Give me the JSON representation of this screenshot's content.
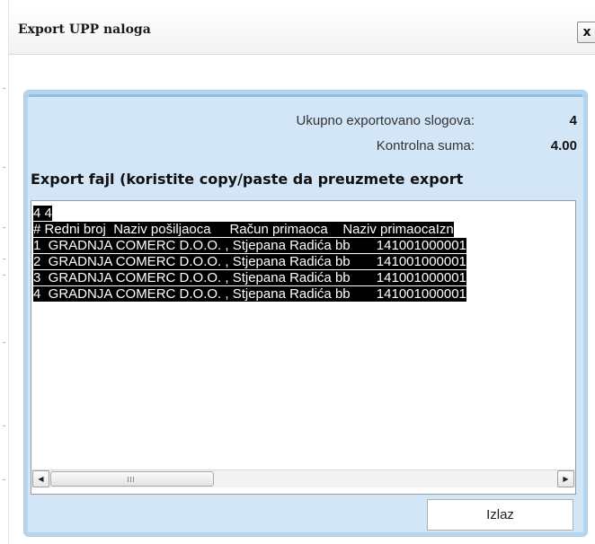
{
  "dialog": {
    "title": "Export UPP naloga",
    "close_label": "x"
  },
  "stats": {
    "total_label": "Ukupno exportovano slogova:",
    "total_value": "4",
    "checksum_label": "Kontrolna suma:",
    "checksum_value": "4.00"
  },
  "export": {
    "heading": "Export fajl (koristite copy/paste da preuzmete export",
    "lines": [
      "4 4",
      "# Redni broj  Naziv pošiljaoca     Račun primaoca    Naziv primaocaIzn",
      "1  GRADNJA COMERC D.O.O. , Stjepana Radića bb       141001000001",
      "2  GRADNJA COMERC D.O.O. , Stjepana Radića bb       141001000001",
      "3  GRADNJA COMERC D.O.O. , Stjepana Radića bb       141001000001",
      "4  GRADNJA COMERC D.O.O. , Stjepana Radića bb       141001000001"
    ]
  },
  "scrollbar": {
    "left_arrow": "◀",
    "right_arrow": "▶"
  },
  "buttons": {
    "exit_label": "Izlaz"
  },
  "colors": {
    "panel_background": "#d2e6f7",
    "selection_background": "#000000",
    "selection_text": "#ffffff"
  }
}
